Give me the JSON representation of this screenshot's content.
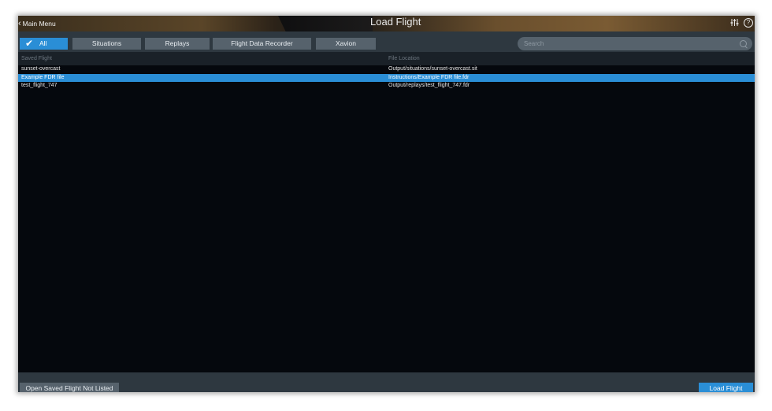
{
  "header": {
    "back_label": "Main Menu",
    "title": "Load Flight",
    "settings_icon": "sliders-icon",
    "help_icon": "help-icon"
  },
  "tabs": [
    {
      "label": "All",
      "active": true
    },
    {
      "label": "Situations",
      "active": false
    },
    {
      "label": "Replays",
      "active": false
    },
    {
      "label": "Flight Data Recorder",
      "active": false
    },
    {
      "label": "Xavion",
      "active": false
    }
  ],
  "search": {
    "placeholder": "Search"
  },
  "table": {
    "columns": [
      "Saved Flight",
      "File Location"
    ],
    "rows": [
      {
        "name": "sunset-overcast",
        "location": "Output/situations/sunset-overcast.sit",
        "selected": false
      },
      {
        "name": "Example FDR file",
        "location": "Instructions/Example FDR file.fdr",
        "selected": true
      },
      {
        "name": "test_flight_747",
        "location": "Output/replays/test_flight_747.fdr",
        "selected": false
      }
    ]
  },
  "footer": {
    "open_label": "Open Saved Flight Not Listed",
    "load_label": "Load Flight"
  },
  "colors": {
    "accent": "#2a8ed6",
    "toolbar": "#2e3840",
    "button": "#56626c",
    "list_bg": "#05080d"
  }
}
